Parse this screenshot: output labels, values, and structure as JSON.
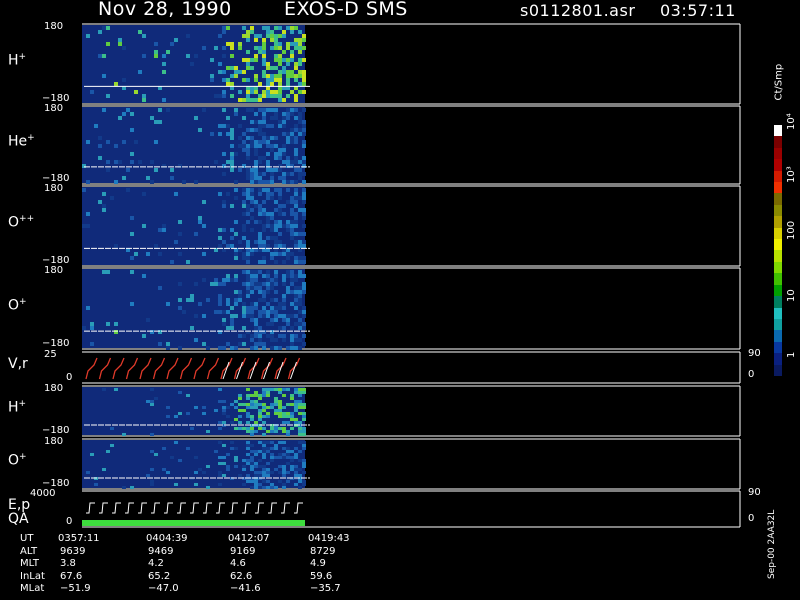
{
  "header": {
    "date": "Nov 28, 1990",
    "instrument": "EXOS-D SMS",
    "file": "s0112801.asr",
    "time": "03:57:11"
  },
  "colors": {
    "background": "#000000",
    "panel_fill": "#102a7a",
    "trace": "#ffffff",
    "velocity_trace": "#e03a2a",
    "quality_bar": "#3ddc3d"
  },
  "colorbar": {
    "unit": "Ct/Smp",
    "labels": [
      "10⁴",
      "10³",
      "100",
      "10",
      "1"
    ],
    "colors": [
      "#ffffff",
      "#7a0000",
      "#9a0000",
      "#b00000",
      "#d41b00",
      "#f03000",
      "#7a6a00",
      "#8a8a00",
      "#b0a000",
      "#d8d000",
      "#f0f000",
      "#b8e000",
      "#80d800",
      "#40c000",
      "#00a000",
      "#008060",
      "#20c0c0",
      "#10a0a0",
      "#0a6ab0",
      "#0838a0",
      "#0a2080",
      "#0a1a60"
    ]
  },
  "panels": [
    {
      "label": "H",
      "sup": "+",
      "top_tick": "180",
      "bottom_tick": "−180"
    },
    {
      "label": "He",
      "sup": "+",
      "top_tick": "180",
      "bottom_tick": "−180"
    },
    {
      "label": "O",
      "sup": "++",
      "top_tick": "180",
      "bottom_tick": "−180"
    },
    {
      "label": "O",
      "sup": "+",
      "top_tick": "180",
      "bottom_tick": "−180"
    },
    {
      "label": "V,r",
      "sup": "",
      "top_tick": "25",
      "bottom_tick": "0",
      "right_top": "90",
      "right_bottom": "0"
    },
    {
      "label": "H",
      "sup": "+",
      "top_tick": "180",
      "bottom_tick": "−180"
    },
    {
      "label": "O",
      "sup": "+",
      "top_tick": "180",
      "bottom_tick": "−180"
    },
    {
      "label": "E,p",
      "sup": "",
      "top_tick": "4000",
      "bottom_tick": "0",
      "right_top": "90",
      "right_bottom": "0",
      "extra_label": "QA"
    }
  ],
  "footer": {
    "rows": [
      {
        "name": "UT",
        "values": [
          "0357:11",
          "0404:39",
          "0412:07",
          "0419:43"
        ]
      },
      {
        "name": "ALT",
        "values": [
          "9639",
          "9469",
          "9169",
          "8729"
        ]
      },
      {
        "name": "MLT",
        "values": [
          "3.8",
          "4.2",
          "4.6",
          "4.9"
        ]
      },
      {
        "name": "InLat",
        "values": [
          "67.6",
          "65.2",
          "62.6",
          "59.6"
        ]
      },
      {
        "name": "MLat",
        "values": [
          "−51.9",
          "−47.0",
          "−41.6",
          "−35.7"
        ]
      }
    ],
    "version": "Sep-00 2AA32L"
  }
}
